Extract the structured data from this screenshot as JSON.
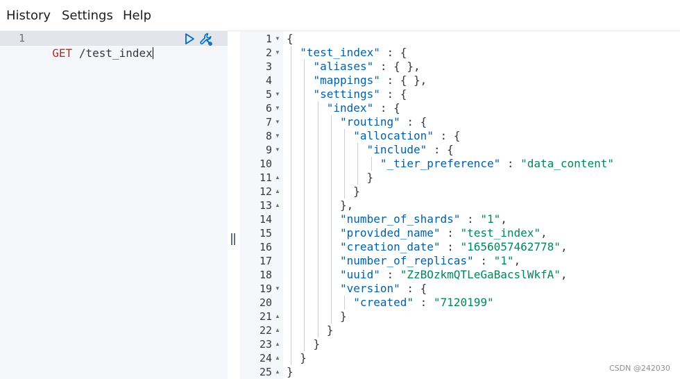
{
  "menu": {
    "history": "History",
    "settings": "Settings",
    "help": "Help"
  },
  "request": {
    "line_number": "1",
    "method": "GET",
    "path": "/test_index",
    "icons": {
      "run": "play-icon",
      "options": "wrench-icon"
    }
  },
  "response": {
    "lines": [
      {
        "n": "1",
        "fold": "▼",
        "indent": 0,
        "tokens": [
          [
            "p",
            "{"
          ]
        ]
      },
      {
        "n": "2",
        "fold": "▼",
        "indent": 1,
        "tokens": [
          [
            "k",
            "\"test_index\""
          ],
          [
            "p",
            " : {"
          ]
        ]
      },
      {
        "n": "3",
        "fold": "",
        "indent": 2,
        "tokens": [
          [
            "k",
            "\"aliases\""
          ],
          [
            "p",
            " : { },"
          ]
        ]
      },
      {
        "n": "4",
        "fold": "",
        "indent": 2,
        "tokens": [
          [
            "k",
            "\"mappings\""
          ],
          [
            "p",
            " : { },"
          ]
        ]
      },
      {
        "n": "5",
        "fold": "▼",
        "indent": 2,
        "tokens": [
          [
            "k",
            "\"settings\""
          ],
          [
            "p",
            " : {"
          ]
        ]
      },
      {
        "n": "6",
        "fold": "▼",
        "indent": 3,
        "tokens": [
          [
            "k",
            "\"index\""
          ],
          [
            "p",
            " : {"
          ]
        ]
      },
      {
        "n": "7",
        "fold": "▼",
        "indent": 4,
        "tokens": [
          [
            "k",
            "\"routing\""
          ],
          [
            "p",
            " : {"
          ]
        ]
      },
      {
        "n": "8",
        "fold": "▼",
        "indent": 5,
        "tokens": [
          [
            "k",
            "\"allocation\""
          ],
          [
            "p",
            " : {"
          ]
        ]
      },
      {
        "n": "9",
        "fold": "▼",
        "indent": 6,
        "tokens": [
          [
            "k",
            "\"include\""
          ],
          [
            "p",
            " : {"
          ]
        ]
      },
      {
        "n": "10",
        "fold": "",
        "indent": 7,
        "tokens": [
          [
            "k",
            "\"_tier_preference\""
          ],
          [
            "p",
            " : "
          ],
          [
            "s",
            "\"data_content\""
          ]
        ]
      },
      {
        "n": "11",
        "fold": "▲",
        "indent": 6,
        "tokens": [
          [
            "p",
            "}"
          ]
        ]
      },
      {
        "n": "12",
        "fold": "▲",
        "indent": 5,
        "tokens": [
          [
            "p",
            "}"
          ]
        ]
      },
      {
        "n": "13",
        "fold": "▲",
        "indent": 4,
        "tokens": [
          [
            "p",
            "},"
          ]
        ]
      },
      {
        "n": "14",
        "fold": "",
        "indent": 4,
        "tokens": [
          [
            "k",
            "\"number_of_shards\""
          ],
          [
            "p",
            " : "
          ],
          [
            "s",
            "\"1\""
          ],
          [
            "p",
            ","
          ]
        ]
      },
      {
        "n": "15",
        "fold": "",
        "indent": 4,
        "tokens": [
          [
            "k",
            "\"provided_name\""
          ],
          [
            "p",
            " : "
          ],
          [
            "s",
            "\"test_index\""
          ],
          [
            "p",
            ","
          ]
        ]
      },
      {
        "n": "16",
        "fold": "",
        "indent": 4,
        "tokens": [
          [
            "k",
            "\"creation_date\""
          ],
          [
            "p",
            " : "
          ],
          [
            "s",
            "\"1656057462778\""
          ],
          [
            "p",
            ","
          ]
        ]
      },
      {
        "n": "17",
        "fold": "",
        "indent": 4,
        "tokens": [
          [
            "k",
            "\"number_of_replicas\""
          ],
          [
            "p",
            " : "
          ],
          [
            "s",
            "\"1\""
          ],
          [
            "p",
            ","
          ]
        ]
      },
      {
        "n": "18",
        "fold": "",
        "indent": 4,
        "tokens": [
          [
            "k",
            "\"uuid\""
          ],
          [
            "p",
            " : "
          ],
          [
            "s",
            "\"ZzBOzkmQTLeGaBacslWkfA\""
          ],
          [
            "p",
            ","
          ]
        ]
      },
      {
        "n": "19",
        "fold": "▼",
        "indent": 4,
        "tokens": [
          [
            "k",
            "\"version\""
          ],
          [
            "p",
            " : {"
          ]
        ]
      },
      {
        "n": "20",
        "fold": "",
        "indent": 5,
        "tokens": [
          [
            "k",
            "\"created\""
          ],
          [
            "p",
            " : "
          ],
          [
            "s",
            "\"7120199\""
          ]
        ]
      },
      {
        "n": "21",
        "fold": "▲",
        "indent": 4,
        "tokens": [
          [
            "p",
            "}"
          ]
        ]
      },
      {
        "n": "22",
        "fold": "▲",
        "indent": 3,
        "tokens": [
          [
            "p",
            "}"
          ]
        ]
      },
      {
        "n": "23",
        "fold": "▲",
        "indent": 2,
        "tokens": [
          [
            "p",
            "}"
          ]
        ]
      },
      {
        "n": "24",
        "fold": "▲",
        "indent": 1,
        "tokens": [
          [
            "p",
            "}"
          ]
        ]
      },
      {
        "n": "25",
        "fold": "▲",
        "indent": 0,
        "tokens": [
          [
            "p",
            "}"
          ]
        ]
      }
    ]
  },
  "watermark": "CSDN @242030",
  "colors": {
    "key": "#0061a6",
    "string": "#00875a",
    "method": "#bd271e",
    "gutter": "#f5f7fa"
  }
}
